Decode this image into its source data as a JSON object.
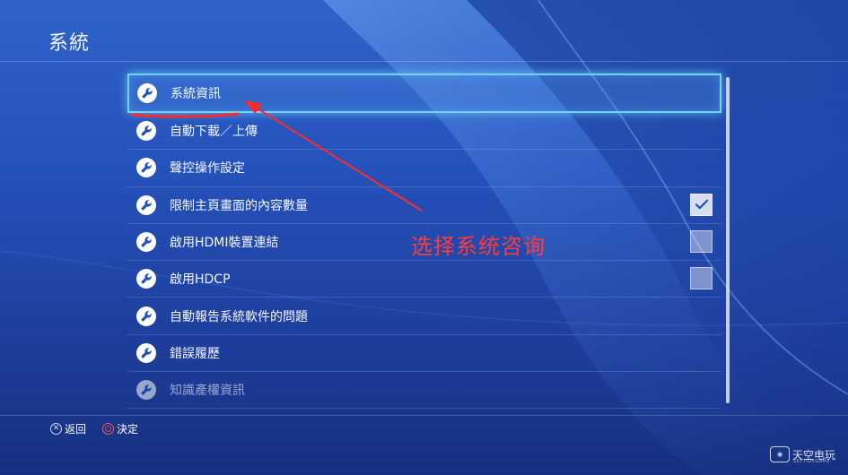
{
  "header": {
    "title": "系統"
  },
  "menu": {
    "items": [
      {
        "label": "系統資訊",
        "icon": "wrench-icon",
        "selected": true
      },
      {
        "label": "自動下載／上傳",
        "icon": "wrench-icon"
      },
      {
        "label": "聲控操作設定",
        "icon": "wrench-icon"
      },
      {
        "label": "限制主頁畫面的內容數量",
        "icon": "wrench-icon",
        "checkbox": "checked"
      },
      {
        "label": "啟用HDMI裝置連結",
        "icon": "wrench-icon",
        "checkbox": "unchecked"
      },
      {
        "label": "啟用HDCP",
        "icon": "wrench-icon",
        "checkbox": "unchecked"
      },
      {
        "label": "自動報告系統軟件的問題",
        "icon": "wrench-icon"
      },
      {
        "label": "錯誤履歷",
        "icon": "wrench-icon"
      },
      {
        "label": "知識產權資訊",
        "icon": "wrench-icon",
        "faded": true
      }
    ]
  },
  "footer": {
    "back_icon": "cross-button-icon",
    "back_label": "返回",
    "confirm_icon": "circle-button-icon",
    "confirm_label": "決定"
  },
  "annotation": {
    "text": "选择系统咨询",
    "color": "#ff3b3b"
  },
  "watermark": {
    "text": "天空电玩",
    "sub": "SKYTIDEGAME"
  },
  "colors": {
    "accent": "#6fd3ff",
    "background": "#2652bb",
    "annotation": "#ff3b3b"
  }
}
